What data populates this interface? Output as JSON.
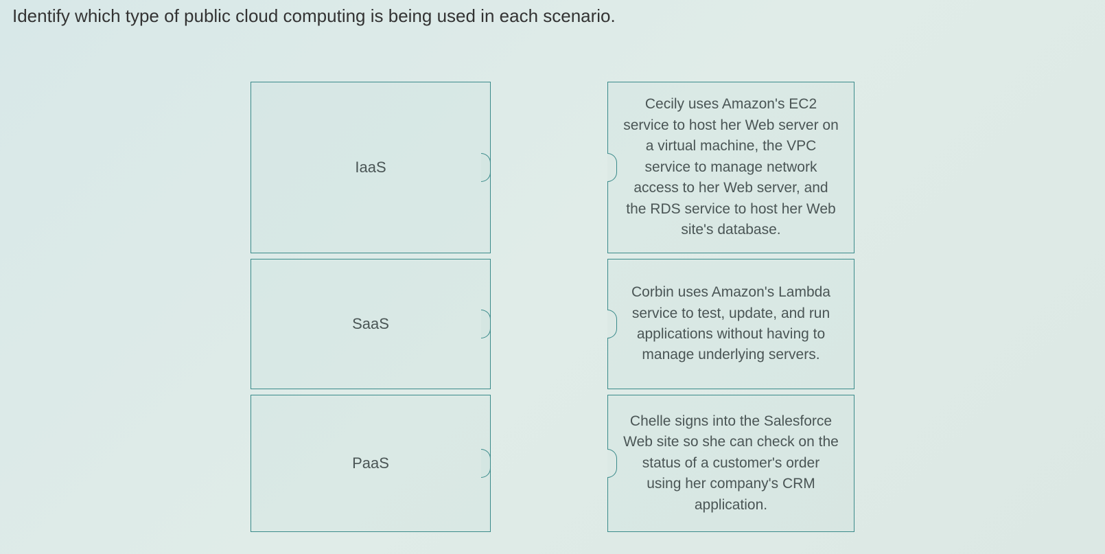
{
  "instruction": "Identify which type of public cloud computing is being used in each scenario.",
  "left": {
    "items": [
      {
        "label": "IaaS"
      },
      {
        "label": "SaaS"
      },
      {
        "label": "PaaS"
      }
    ]
  },
  "right": {
    "items": [
      {
        "text": "Cecily uses Amazon's EC2 service to host her Web server on a virtual machine, the VPC service to manage network access to her Web server, and the RDS service to host her Web site's database."
      },
      {
        "text": "Corbin uses Amazon's Lambda service to test, update, and run applications without having to manage underlying servers."
      },
      {
        "text": "Chelle signs into the Salesforce Web site so she can check on the status of a customer's order using her company's CRM application."
      }
    ]
  }
}
